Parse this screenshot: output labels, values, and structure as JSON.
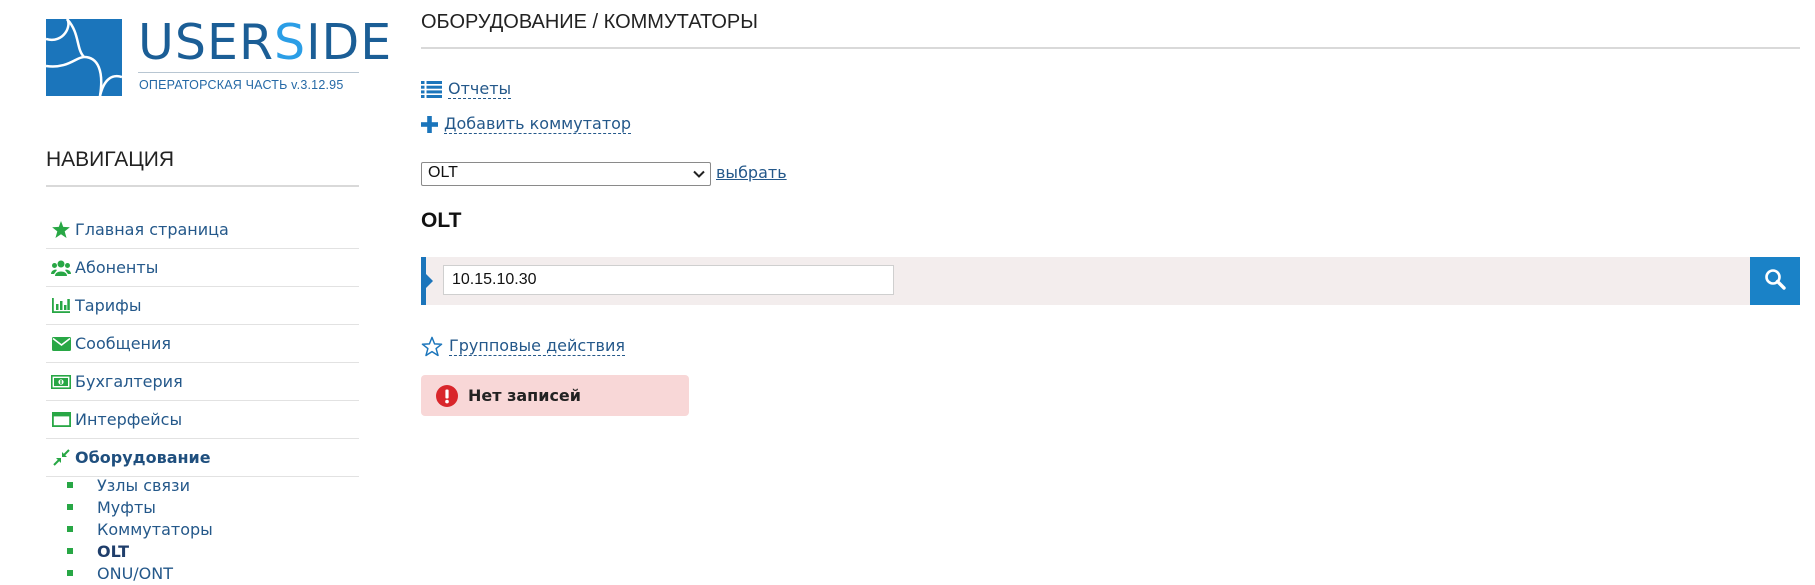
{
  "logo": {
    "name_prefix": "U",
    "name_part1": "SER",
    "name_s": "S",
    "name_part2": "IDE",
    "subtitle": "ОПЕРАТОРСКАЯ ЧАСТЬ v.3.12.95"
  },
  "sidebar": {
    "title": "НАВИГАЦИЯ",
    "items": [
      {
        "label": "Главная страница",
        "icon": "star-icon"
      },
      {
        "label": "Абоненты",
        "icon": "users-icon"
      },
      {
        "label": "Тарифы",
        "icon": "bar-chart-icon"
      },
      {
        "label": "Сообщения",
        "icon": "envelope-icon"
      },
      {
        "label": "Бухгалтерия",
        "icon": "money-icon"
      },
      {
        "label": "Интерфейсы",
        "icon": "window-icon"
      },
      {
        "label": "Оборудование",
        "icon": "compress-icon",
        "active": true
      }
    ],
    "subitems": [
      {
        "label": "Узлы связи"
      },
      {
        "label": "Муфты"
      },
      {
        "label": "Коммутаторы"
      },
      {
        "label": "OLT",
        "current": true
      },
      {
        "label": "ONU/ONT"
      }
    ]
  },
  "main": {
    "title": "ОБОРУДОВАНИЕ / КОММУТАТОРЫ",
    "reports_link": "Отчеты",
    "add_switch_link": "Добавить коммутатор",
    "select": {
      "value": "OLT"
    },
    "choose_link": "выбрать",
    "section_heading": "OLT",
    "search": {
      "value": "10.15.10.30"
    },
    "group_actions_link": "Групповые действия",
    "no_records": "Нет записей"
  },
  "colors": {
    "brand_blue": "#1b75bb",
    "nav_green": "#28a745",
    "link_blue": "#24588a",
    "search_bg": "#f3eded",
    "alert_bg": "#f8d7d7",
    "alert_icon": "#d9262b"
  }
}
